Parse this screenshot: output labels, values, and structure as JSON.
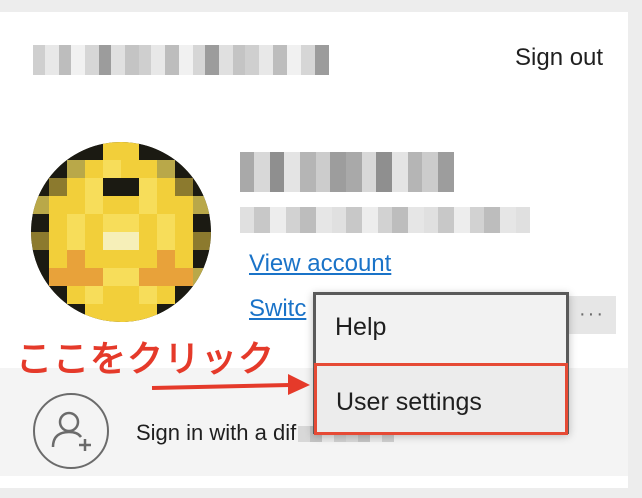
{
  "header": {
    "sign_out_label": "Sign out"
  },
  "account": {
    "view_account_label": "View account",
    "switch_label": "Switc",
    "more_label": "···"
  },
  "footer": {
    "sign_in_other_label": "Sign in with a dif"
  },
  "menu": {
    "items": [
      {
        "label": "Help"
      },
      {
        "label": "User settings"
      }
    ]
  },
  "annotation": {
    "text": "ここをクリック",
    "color": "#e53a2a"
  },
  "colors": {
    "link": "#1a73c8",
    "highlight": "#e64a35"
  }
}
